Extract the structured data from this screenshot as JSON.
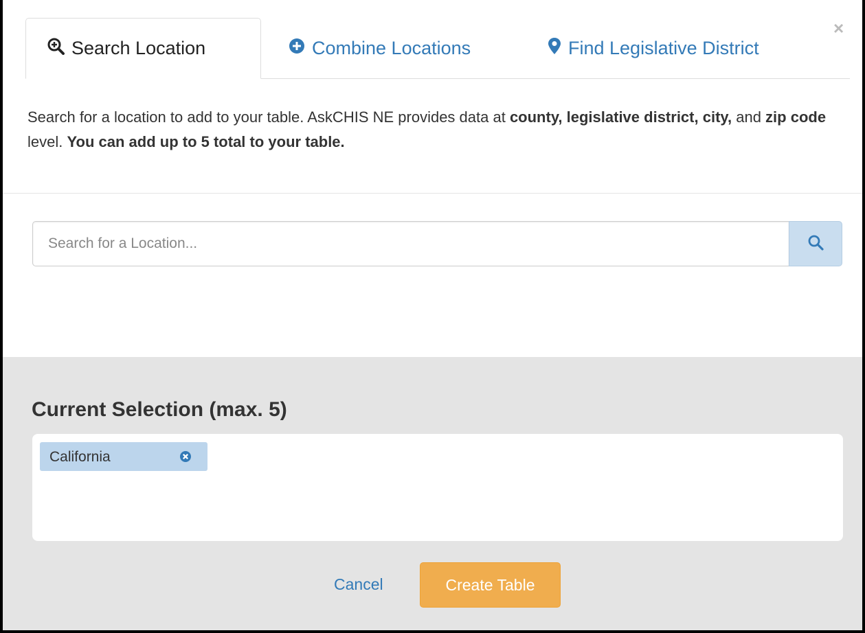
{
  "tabs": [
    {
      "label": "Search Location",
      "icon": "zoom-in-icon",
      "active": true
    },
    {
      "label": "Combine Locations",
      "icon": "plus-circle-icon",
      "active": false
    },
    {
      "label": "Find Legislative District",
      "icon": "map-marker-icon",
      "active": false
    }
  ],
  "close_label": "×",
  "description": {
    "part1": "Search for a location to add to your table. AskCHIS NE provides data at ",
    "bold1": "county, legislative district, city,",
    "part2": " and ",
    "bold2": "zip code",
    "part3": " level. ",
    "bold3": "You can add up to 5 total to your table."
  },
  "search": {
    "placeholder": "Search for a Location...",
    "value": ""
  },
  "selection": {
    "title": "Current Selection (max. 5)",
    "items": [
      "California"
    ]
  },
  "footer": {
    "cancel_label": "Cancel",
    "create_label": "Create Table"
  },
  "colors": {
    "link": "#337ab7",
    "primary_orange": "#f0ad4e",
    "chip": "#bcd5ec",
    "panel": "#e4e4e4"
  }
}
